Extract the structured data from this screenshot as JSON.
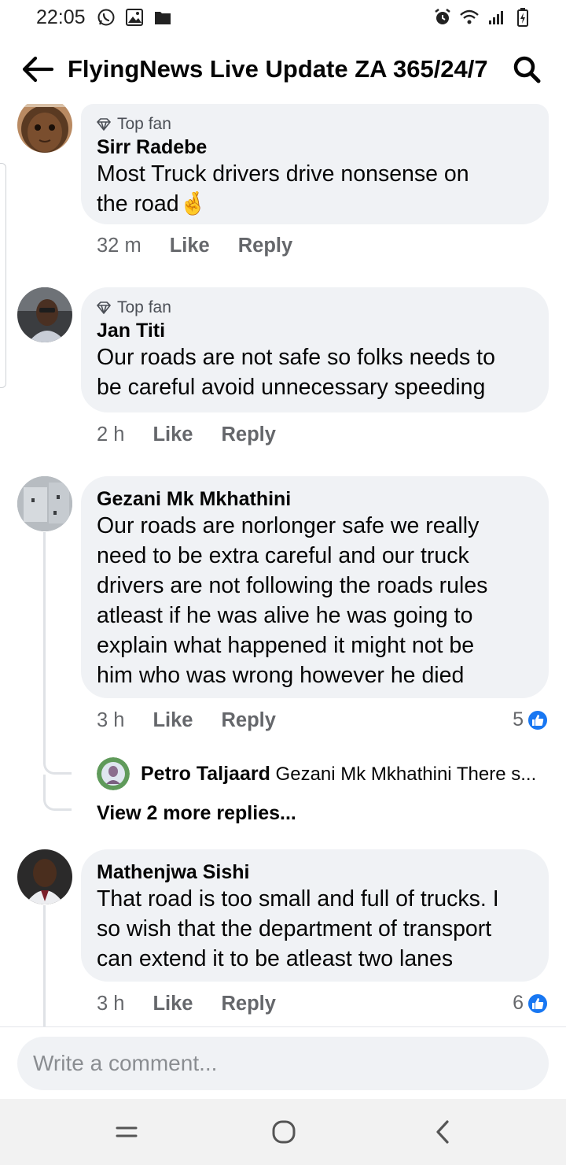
{
  "status_bar": {
    "time": "22:05",
    "left_icons": [
      "whatsapp-icon",
      "gallery-icon",
      "folder-icon"
    ],
    "right_icons": [
      "alarm-icon",
      "wifi-icon",
      "signal-icon",
      "battery-icon"
    ]
  },
  "header": {
    "title": "FlyingNews Live Update ZA 365/24/7"
  },
  "comments": [
    {
      "badge": "Top fan",
      "author": "Sirr Radebe",
      "text_lines": [
        "Most Truck drivers drive nonsense on",
        "the road"
      ],
      "emoji": "🤞",
      "time": "32 m",
      "like_label": "Like",
      "reply_label": "Reply"
    },
    {
      "badge": "Top fan",
      "author": "Jan Titi",
      "text_lines": [
        "Our roads are not safe so folks needs to",
        "be careful avoid unnecessary speeding"
      ],
      "time": "2 h",
      "like_label": "Like",
      "reply_label": "Reply"
    },
    {
      "author": "Gezani Mk Mkhathini",
      "text_lines": [
        "Our roads are norlonger safe we really",
        "need to be extra careful and our truck",
        "drivers are not following the roads rules",
        "atleast if he was alive he was going to",
        "explain what happened it might not be",
        "him who was wrong however he died"
      ],
      "time": "3 h",
      "like_label": "Like",
      "reply_label": "Reply",
      "reaction_count": "5",
      "reply_preview": {
        "author": "Petro Taljaard",
        "text": "Gezani Mk Mkhathini There s..."
      },
      "view_more": "View 2 more replies..."
    },
    {
      "author": "Mathenjwa Sishi",
      "text_lines": [
        "That road is too small and full of trucks. I",
        "so wish that the department of transport",
        "can extend it to be atleast two lanes"
      ],
      "time": "3 h",
      "like_label": "Like",
      "reply_label": "Reply",
      "reaction_count": "6"
    }
  ],
  "composer": {
    "placeholder": "Write a comment..."
  },
  "colors": {
    "accent_blue": "#1877f2",
    "bubble_bg": "#f0f2f5",
    "meta_gray": "#65676b"
  }
}
